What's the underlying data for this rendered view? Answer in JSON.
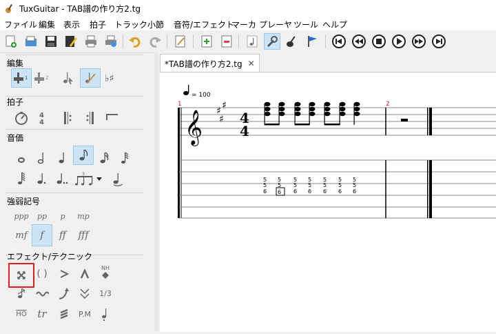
{
  "window": {
    "title": "TuxGuitar - TAB譜の作り方2.tg",
    "app_icon": "guitar-icon"
  },
  "menu": {
    "items": [
      "ファイル",
      "編集",
      "表示",
      "拍子",
      "トラック",
      "小節",
      "音符/エフェクト",
      "マーカ",
      "プレーヤ",
      "ツール",
      "ヘルプ"
    ]
  },
  "toolbar": {
    "icons": [
      "new-file-icon",
      "open-icon",
      "save-icon",
      "properties-icon",
      "print-icon",
      "print-preview-icon",
      "undo-icon",
      "redo-icon",
      "edit-mode-icon",
      "add-track-icon",
      "remove-track-icon",
      "note-icon",
      "settings-icon",
      "guitar-settings-icon",
      "flag-icon",
      "first-icon",
      "rewind-icon",
      "stop-icon",
      "play-icon",
      "fast-forward-icon",
      "last-icon"
    ]
  },
  "panel": {
    "edit": {
      "title": "編集"
    },
    "time": {
      "title": "拍子"
    },
    "duration": {
      "title": "音価"
    },
    "dynamics": {
      "title": "強弱記号",
      "row1": [
        "ppp",
        "pp",
        "p",
        "mp"
      ],
      "row2": [
        "mf",
        "f",
        "ff",
        "fff"
      ]
    },
    "effects": {
      "title": "エフェクト/テクニック",
      "paren": "( )",
      "nh": "NH",
      "tuplet": "1/3",
      "ho": "HO",
      "tr": "tr",
      "pm": "P.M"
    }
  },
  "editor": {
    "tab_label": "*TAB譜の作り方2.tg",
    "tempo": "= 100",
    "measure1": "1",
    "measure2": "2",
    "time_sig_top": "4",
    "time_sig_bottom": "4",
    "tab_col": [
      "5",
      "5",
      "6"
    ],
    "tab_boxed": "6"
  }
}
